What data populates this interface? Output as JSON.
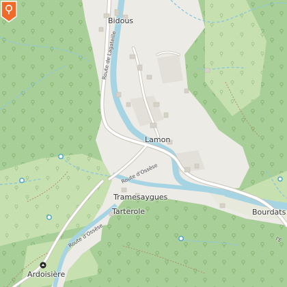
{
  "map": {
    "colors": {
      "forest": "#a9cf98",
      "meadow": "#c6e0b0",
      "settlement": "#ecebe6",
      "river": "#a7d4e3",
      "stream": "#8fc7dd",
      "road": "#ffffff",
      "road_casing": "#c9c3b8",
      "marker": "#f06a2a"
    },
    "places": {
      "bidous": "Bidous",
      "lamon": "Lamon",
      "tramesaygues": "Tramesaygues",
      "tarterole": "Tarterole",
      "bourdats": "Bourdats",
      "ardoisiere": "Ardoisière"
    },
    "roads": {
      "route_lagateille": "Route de Lagateille",
      "route_ossese_1": "Route d'Ossèse",
      "route_ossese_2": "Route d'Ossèse",
      "edge_label": "l'E"
    },
    "marker_icon": "location-pin-icon",
    "poi_icon": "mine-icon"
  }
}
